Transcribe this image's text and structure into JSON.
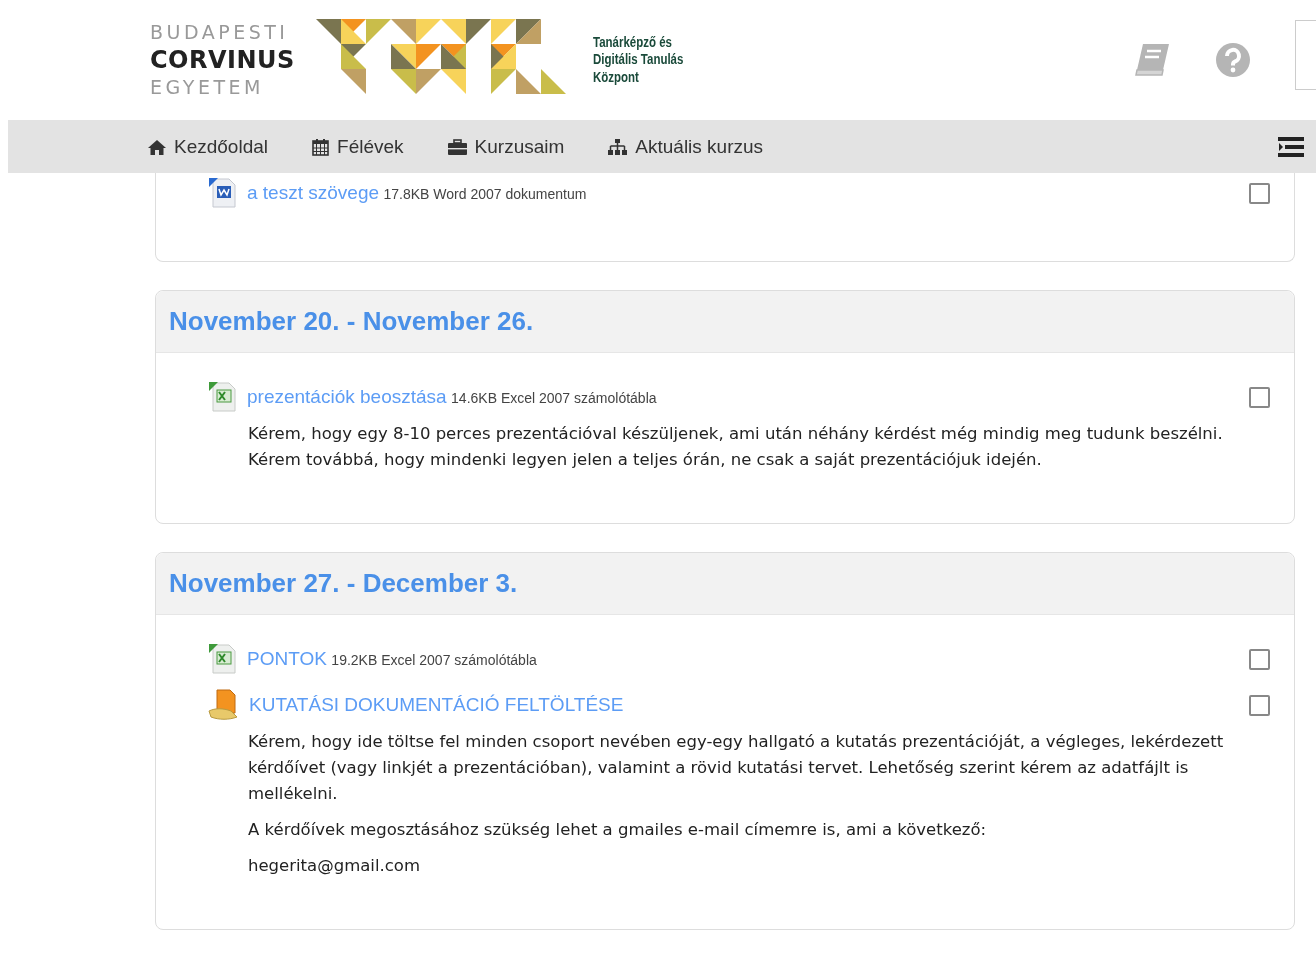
{
  "header": {
    "university_logo": [
      "BUDAPESTI",
      "CORVINUS",
      "EGYETEM"
    ],
    "center_logo_text": [
      "Tanárképző és",
      "Digitális Tanulás",
      "Központ"
    ]
  },
  "nav": {
    "items": [
      {
        "kind": "home",
        "label": "Kezdőoldal"
      },
      {
        "kind": "calendar",
        "label": "Félévek"
      },
      {
        "kind": "briefcase",
        "label": "Kurzusaim"
      },
      {
        "kind": "sitemap",
        "label": "Aktuális kurzus"
      }
    ]
  },
  "sections": [
    {
      "activities": [
        {
          "kind": "word",
          "name": "a teszt szövege",
          "size": "17.8KB",
          "type": "Word 2007 dokumentum",
          "checked": false
        }
      ]
    },
    {
      "title": "November 20. - November 26.",
      "activities": [
        {
          "kind": "excel",
          "name": "prezentációk beosztása",
          "size": "14.6KB",
          "type": "Excel 2007 számolótábla",
          "checked": false,
          "description": [
            "Kérem, hogy egy 8-10 perces prezentációval készüljenek, ami után néhány kérdést még mindig meg tudunk beszélni. Kérem továbbá, hogy mindenki legyen jelen a teljes órán, ne csak a saját prezentációjuk idején."
          ]
        }
      ]
    },
    {
      "title": "November 27. - December 3.",
      "activities": [
        {
          "kind": "excel",
          "name": "PONTOK",
          "size": "19.2KB",
          "type": "Excel 2007 számolótábla",
          "checked": false
        },
        {
          "kind": "assignment",
          "name": "KUTATÁSI DOKUMENTÁCIÓ FELTÖLTÉSE",
          "checked": false,
          "description": [
            "Kérem, hogy ide töltse fel minden csoport nevében egy-egy hallgató a kutatás prezentációját, a végleges, lekérdezett kérdőívet (vagy linkjét a prezentációban), valamint a rövid kutatási tervet. Lehetőség szerint kérem az adatfájlt is mellékelni.",
            "A kérdőívek megosztásához szükség lehet a gmailes e-mail címemre is, ami a következő:",
            "hegerita@gmail.com"
          ]
        }
      ]
    }
  ]
}
